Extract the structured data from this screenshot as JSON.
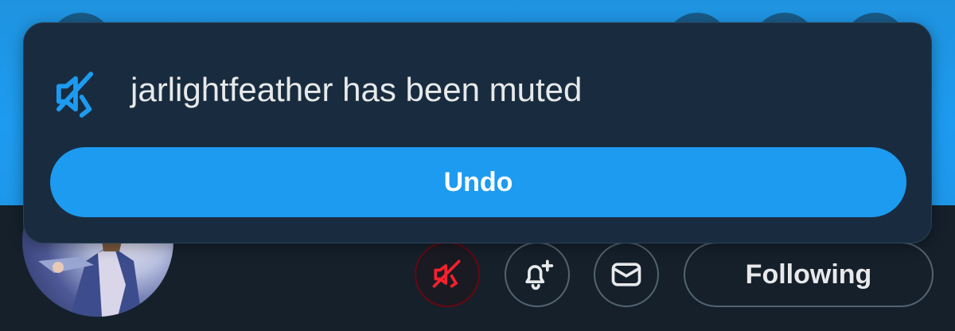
{
  "toast": {
    "message": "jarlightfeather has been muted",
    "undo_label": "Undo",
    "icon": "mute-icon"
  },
  "profile": {
    "following_label": "Following",
    "icons": [
      "mute-icon",
      "notification-bell-add-icon",
      "message-envelope-icon"
    ]
  },
  "colors": {
    "accent": "#1d9bf0",
    "background": "#15202b",
    "toast_background": "#192c3f",
    "muted_red": "#f4212e",
    "text": "#e7e9ea"
  }
}
